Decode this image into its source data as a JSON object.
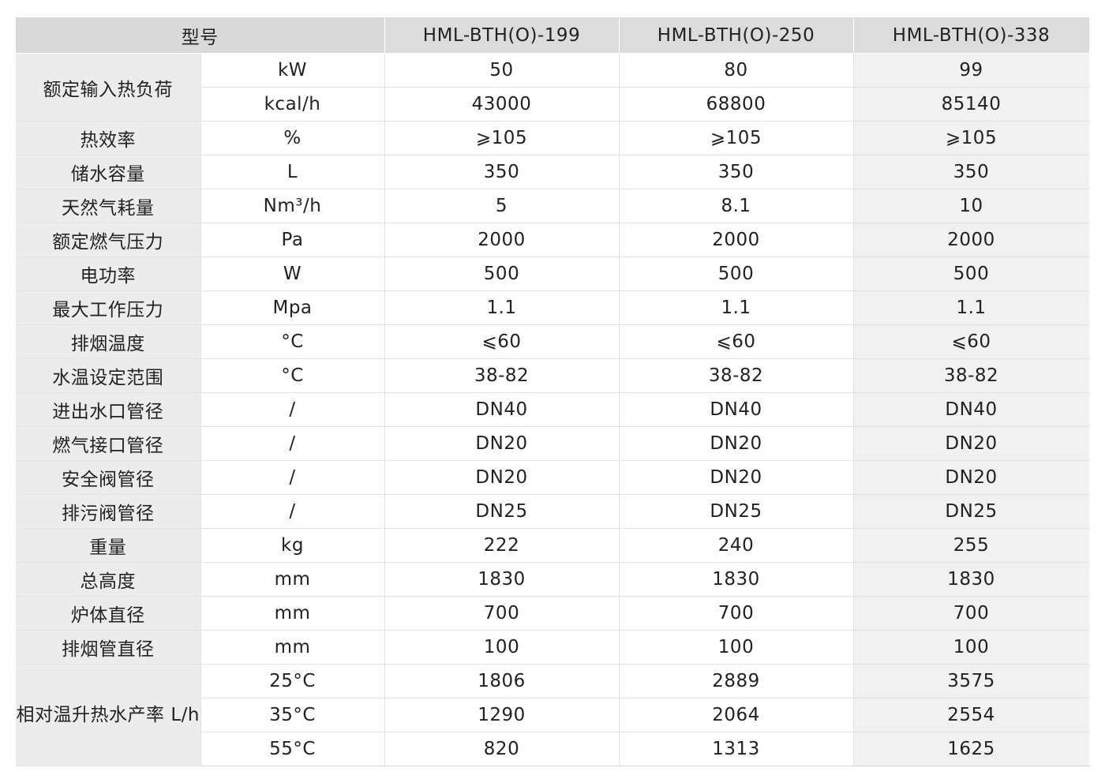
{
  "header": {
    "model_label": "型号",
    "models": [
      "HML-BTH(O)-199",
      "HML-BTH(O)-250",
      "HML-BTH(O)-338"
    ]
  },
  "rows": [
    {
      "name": "额定输入热负荷",
      "unit": "kW",
      "values": [
        "50",
        "80",
        "99"
      ]
    },
    {
      "name": "",
      "unit": "kcal/h",
      "values": [
        "43000",
        "68800",
        "85140"
      ]
    },
    {
      "name": "热效率",
      "unit": "%",
      "values": [
        "⩾105",
        "⩾105",
        "⩾105"
      ]
    },
    {
      "name": "储水容量",
      "unit": "L",
      "values": [
        "350",
        "350",
        "350"
      ]
    },
    {
      "name": "天然气耗量",
      "unit": "Nm³/h",
      "values": [
        "5",
        "8.1",
        "10"
      ]
    },
    {
      "name": "额定燃气压力",
      "unit": "Pa",
      "values": [
        "2000",
        "2000",
        "2000"
      ]
    },
    {
      "name": "电功率",
      "unit": "W",
      "values": [
        "500",
        "500",
        "500"
      ]
    },
    {
      "name": "最大工作压力",
      "unit": "Mpa",
      "values": [
        "1.1",
        "1.1",
        "1.1"
      ]
    },
    {
      "name": "排烟温度",
      "unit": "°C",
      "values": [
        "⩽60",
        "⩽60",
        "⩽60"
      ]
    },
    {
      "name": "水温设定范围",
      "unit": "°C",
      "values": [
        "38-82",
        "38-82",
        "38-82"
      ]
    },
    {
      "name": "进出水口管径",
      "unit": "/",
      "values": [
        "DN40",
        "DN40",
        "DN40"
      ]
    },
    {
      "name": "燃气接口管径",
      "unit": "/",
      "values": [
        "DN20",
        "DN20",
        "DN20"
      ]
    },
    {
      "name": "安全阀管径",
      "unit": "/",
      "values": [
        "DN20",
        "DN20",
        "DN20"
      ]
    },
    {
      "name": "排污阀管径",
      "unit": "/",
      "values": [
        "DN25",
        "DN25",
        "DN25"
      ]
    },
    {
      "name": "重量",
      "unit": "kg",
      "values": [
        "222",
        "240",
        "255"
      ]
    },
    {
      "name": "总高度",
      "unit": "mm",
      "values": [
        "1830",
        "1830",
        "1830"
      ]
    },
    {
      "name": "炉体直径",
      "unit": "mm",
      "values": [
        "700",
        "700",
        "700"
      ]
    },
    {
      "name": "排烟管直径",
      "unit": "mm",
      "values": [
        "100",
        "100",
        "100"
      ]
    },
    {
      "name": "相对温升热水产率 L/h",
      "unit": "25°C",
      "values": [
        "1806",
        "2889",
        "3575"
      ]
    },
    {
      "name": "",
      "unit": "35°C",
      "values": [
        "1290",
        "2064",
        "2554"
      ]
    },
    {
      "name": "",
      "unit": "55°C",
      "values": [
        "820",
        "1313",
        "1625"
      ]
    }
  ]
}
